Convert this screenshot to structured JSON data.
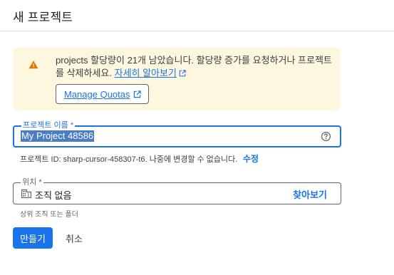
{
  "page": {
    "title": "새 프로젝트"
  },
  "warning": {
    "icon": "warning-icon",
    "message": "projects 할당량이 21개 남았습니다. 할당량 증가를 요청하거나 프로젝트를 삭제하세요.",
    "learn_more_label": "자세히 알아보기",
    "manage_quotas_label": "Manage Quotas",
    "background_color": "#fef7e0",
    "icon_color": "#e37400"
  },
  "project_name": {
    "label": "프로젝트 이름",
    "required_mark": "*",
    "value": "My Project 48586",
    "help_icon": "help-circle-icon"
  },
  "project_id": {
    "text": "프로젝트 ID: sharp-cursor-458307-t6. 나중에 변경할 수 없습니다.",
    "edit_label": "수정"
  },
  "location": {
    "label": "위치",
    "required_mark": "*",
    "value": "조직 없음",
    "icon": "organization-icon",
    "browse_label": "찾아보기",
    "hint": "상위 조직 또는 폴더"
  },
  "actions": {
    "create_label": "만들기",
    "cancel_label": "취소",
    "accent_color": "#1a73e8"
  }
}
